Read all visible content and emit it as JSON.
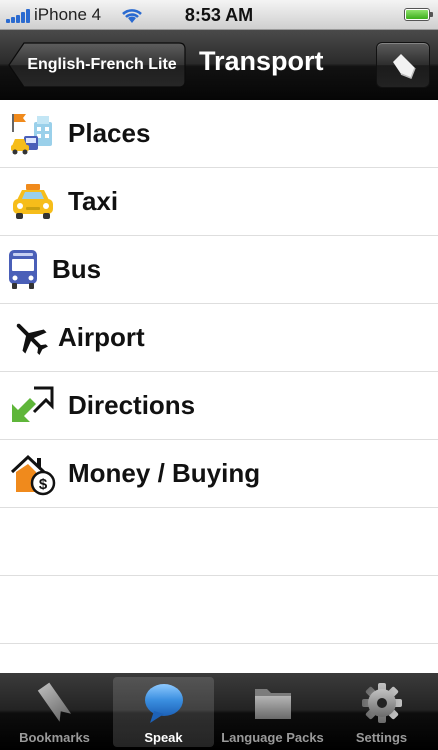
{
  "status_bar": {
    "carrier": "iPhone 4",
    "time": "8:53 AM"
  },
  "nav": {
    "back_label": "English-French Lite",
    "title": "Transport"
  },
  "list": {
    "items": [
      {
        "label": "Places",
        "icon": "places-icon"
      },
      {
        "label": "Taxi",
        "icon": "taxi-icon"
      },
      {
        "label": "Bus",
        "icon": "bus-icon"
      },
      {
        "label": "Airport",
        "icon": "airplane-icon"
      },
      {
        "label": "Directions",
        "icon": "directions-arrow-icon"
      },
      {
        "label": "Money / Buying",
        "icon": "money-house-icon"
      }
    ]
  },
  "tabs": [
    {
      "label": "Bookmarks",
      "icon": "bookmark-icon"
    },
    {
      "label": "Speak",
      "icon": "speech-bubble-icon",
      "active": true
    },
    {
      "label": "Language Packs",
      "icon": "folder-icon"
    },
    {
      "label": "Settings",
      "icon": "gear-icon"
    }
  ],
  "colors": {
    "nav_bar": "#1a1a1a",
    "tab_bar": "#111111",
    "speak_active": "#3b8fe0",
    "signal": "#2a6ad0",
    "battery": "#3cae1c"
  }
}
